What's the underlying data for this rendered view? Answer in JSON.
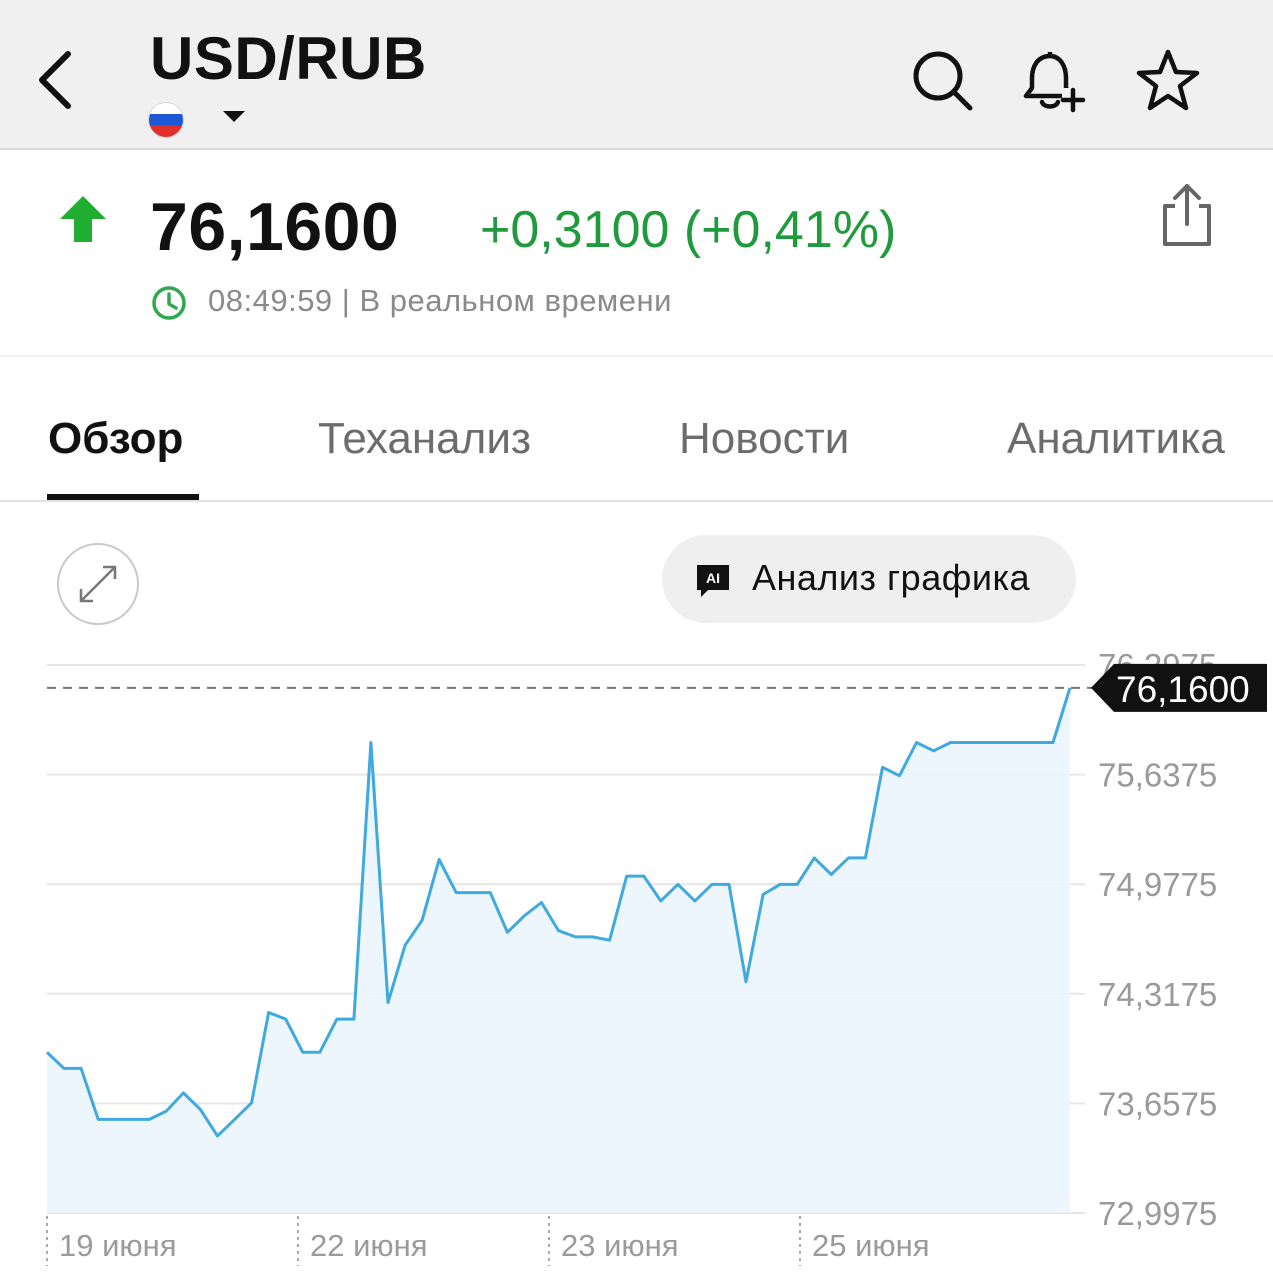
{
  "header": {
    "title": "USD/RUB",
    "back_icon": "chevron-left-icon",
    "flag_icon": "russia-flag-icon",
    "icons": [
      "search-icon",
      "bell-plus-icon",
      "star-outline-icon"
    ]
  },
  "quote": {
    "price": "76,1600",
    "change": "+0,3100 (+0,41%)",
    "time_status": "08:49:59 | В реальном времени",
    "direction_icon": "up-arrow-icon",
    "share_icon": "share-icon",
    "colors": {
      "up": "#1f9a3c",
      "arrow": "#1fae2f"
    }
  },
  "tabs": [
    {
      "label": "Обзор",
      "active": true
    },
    {
      "label": "Теханализ",
      "active": false
    },
    {
      "label": "Новости",
      "active": false
    },
    {
      "label": "Аналитика",
      "active": false
    }
  ],
  "chart_toolbar": {
    "expand_icon": "expand-icon",
    "ai_badge": "AI",
    "ai_button_label": "Анализ графика"
  },
  "chart_data": {
    "type": "area",
    "y_ticks": [
      "76,2975",
      "75,6375",
      "74,9775",
      "74,3175",
      "73,6575",
      "72,9975"
    ],
    "y_tick_values": [
      76.2975,
      75.6375,
      74.9775,
      74.3175,
      73.6575,
      72.9975
    ],
    "ylim": [
      72.9975,
      76.2975
    ],
    "x_ticks": [
      "19 июня",
      "22 июня",
      "23 июня",
      "25 июня"
    ],
    "current_value_label": "76,1600",
    "current_value": 76.16,
    "grid": true,
    "colors": {
      "line": "#3fa9e0",
      "fill": "#eaf4fb",
      "grid": "#e6e6e6",
      "tag": "#111111"
    },
    "values": [
      73.965,
      73.868,
      73.868,
      73.561,
      73.561,
      73.561,
      73.561,
      73.611,
      73.721,
      73.621,
      73.462,
      73.561,
      73.661,
      74.205,
      74.165,
      73.965,
      73.965,
      74.165,
      74.165,
      75.831,
      74.265,
      74.61,
      74.76,
      75.126,
      74.927,
      74.927,
      74.927,
      74.688,
      74.788,
      74.867,
      74.698,
      74.66,
      74.66,
      74.64,
      75.026,
      75.026,
      74.877,
      74.976,
      74.877,
      74.976,
      74.976,
      74.39,
      74.916,
      74.976,
      74.976,
      75.136,
      75.036,
      75.136,
      75.136,
      75.681,
      75.631,
      75.831,
      75.781,
      75.831,
      75.831,
      75.831,
      75.831,
      75.831,
      75.831,
      75.831,
      76.16
    ]
  }
}
